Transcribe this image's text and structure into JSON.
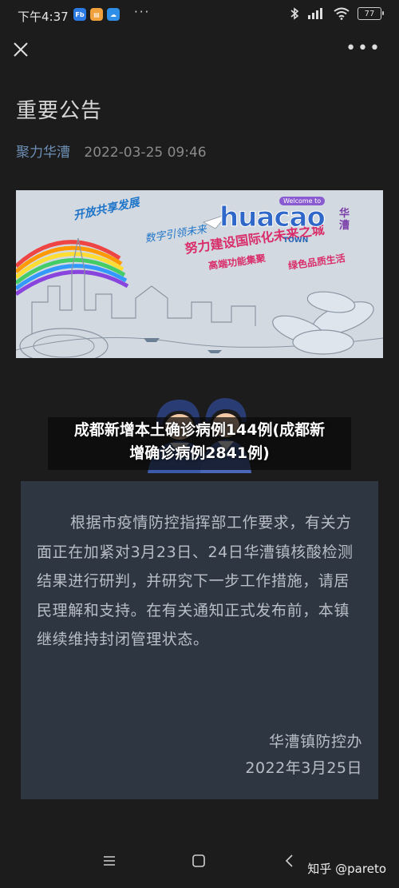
{
  "status_bar": {
    "time": "下午4:37",
    "app_icons": [
      "fb-app-icon",
      "note-app-icon",
      "cloud-app-icon"
    ],
    "more": "···",
    "battery": "77"
  },
  "nav": {
    "close_icon": "close-icon",
    "more_icon": "more-icon"
  },
  "article": {
    "title": "重要公告",
    "author": "聚力华漕",
    "date": "2022-03-25 09:46"
  },
  "banner": {
    "slogan_1": "开放共享发展",
    "slogan_2": "数字引领未来",
    "slogan_3": "努力建设国际化未来之城",
    "slogan_4": "高端功能集聚",
    "slogan_5": "绿色品质生活",
    "logo_word": "huacao",
    "logo_welcome": "Welcome to",
    "logo_town": "TOWN",
    "logo_cn": "华漕",
    "sky_color": "#cfd6de"
  },
  "headline_overlay": {
    "line_1": "成都新增本土确诊病例144例(成都新",
    "line_2": "增确诊病例2841例)"
  },
  "notice": {
    "lines": [
      "根据市疫情防控指挥部工作要求，有",
      "关方面正在加紧对3月23日、24日华漕镇",
      "核酸检测结果进行研判，并研究下一步工",
      "作措施，请居民理解和支持。在有关通知",
      "正式发布前，本镇继续维持封闭管理状",
      "态。"
    ],
    "signature": "华漕镇防控办",
    "sign_date": "2022年3月25日",
    "card_color": "#2e3642"
  },
  "bottom_nav": {
    "menu_icon": "menu-icon",
    "home_icon": "home-square-icon",
    "back_icon": "back-chevron-icon"
  },
  "watermark": "知乎 @pareto"
}
